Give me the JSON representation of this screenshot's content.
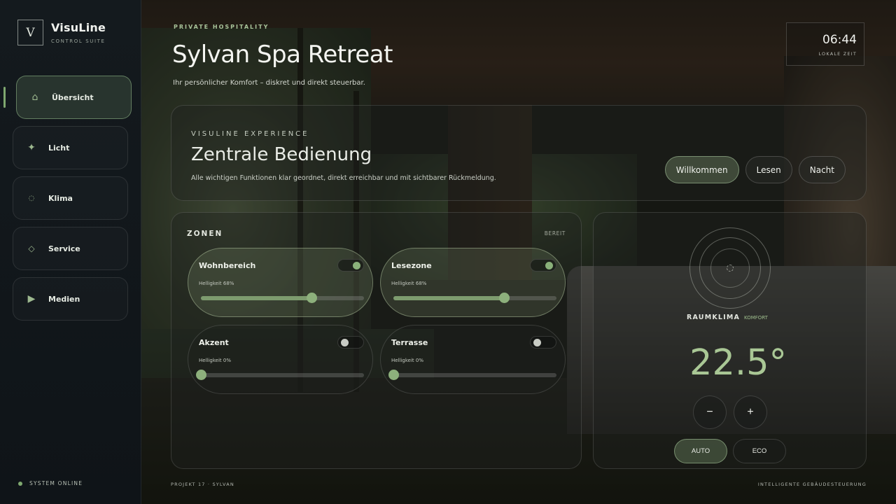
{
  "brand": {
    "mark": "V",
    "title": "VisuLine",
    "subtitle": "CONTROL SUITE"
  },
  "nav": {
    "items": [
      {
        "label": "Übersicht",
        "icon": "home-icon",
        "active": true
      },
      {
        "label": "Licht",
        "icon": "sparkle-icon"
      },
      {
        "label": "Klima",
        "icon": "circle-icon"
      },
      {
        "label": "Service",
        "icon": "diamond-icon"
      },
      {
        "label": "Medien",
        "icon": "play-icon"
      }
    ]
  },
  "system_status": "SYSTEM ONLINE",
  "header": {
    "eyebrow": "PRIVATE HOSPITALITY",
    "title": "Sylvan Spa Retreat",
    "subtitle": "Ihr persönlicher Komfort – diskret und direkt steuerbar."
  },
  "clock": {
    "time": "06:44",
    "label": "LOKALE ZEIT"
  },
  "experience": {
    "eyebrow": "VISULINE EXPERIENCE",
    "title": "Zentrale Bedienung",
    "description": "Alle wichtigen Funktionen klar geordnet, direkt erreichbar und mit sichtbarer Rückmeldung.",
    "scenes": [
      {
        "label": "Willkommen",
        "active": true
      },
      {
        "label": "Lesen"
      },
      {
        "label": "Nacht"
      }
    ]
  },
  "zones": {
    "title": "ZONEN",
    "status": "BEREIT",
    "items": [
      {
        "name": "Wohnbereich",
        "brightness_label": "Helligkeit 68%",
        "brightness": 68,
        "on": true
      },
      {
        "name": "Lesezone",
        "brightness_label": "Helligkeit 68%",
        "brightness": 68,
        "on": true
      },
      {
        "name": "Akzent",
        "brightness_label": "Helligkeit 0%",
        "brightness": 0,
        "on": false
      },
      {
        "name": "Terrasse",
        "brightness_label": "Helligkeit 0%",
        "brightness": 0,
        "on": false
      }
    ]
  },
  "climate": {
    "label": "RAUMKLIMA",
    "mode_label": "KOMFORT",
    "temperature": "22.5°",
    "decrease": "−",
    "increase": "+",
    "modes": [
      {
        "label": "AUTO",
        "active": true
      },
      {
        "label": "ECO"
      }
    ]
  },
  "footer": {
    "left": "PROJEKT 17 · SYLVAN",
    "right": "INTELLIGENTE GEBÄUDESTEUERUNG"
  },
  "colors": {
    "accent": "#7fa86f",
    "accent_light": "#a9c795",
    "sidebar": "#141a1e"
  }
}
